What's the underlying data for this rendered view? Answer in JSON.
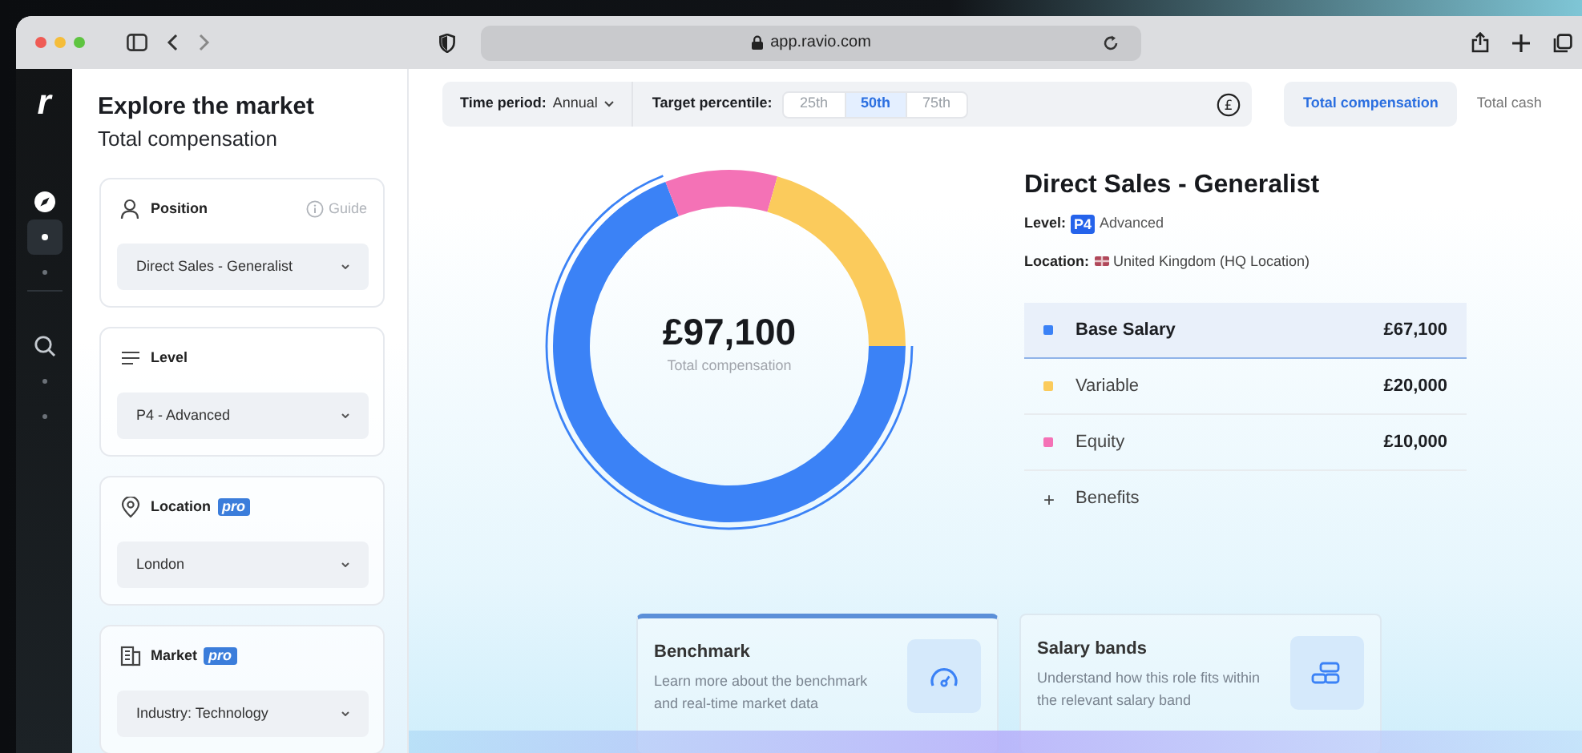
{
  "browser": {
    "url": "app.ravio.com"
  },
  "sidebar": {
    "logo": "r",
    "items": [
      {
        "kind": "compass",
        "selected": false
      },
      {
        "kind": "dot",
        "selected": true
      },
      {
        "kind": "dot",
        "selected": false
      },
      {
        "kind": "search",
        "selected": false
      },
      {
        "kind": "dot",
        "selected": false
      },
      {
        "kind": "dot",
        "selected": false
      }
    ]
  },
  "header": {
    "title": "Explore the market",
    "subtitle": "Total compensation"
  },
  "filters": [
    {
      "kind": "person",
      "label": "Position",
      "guide": "Guide",
      "value": "Direct Sales - Generalist"
    },
    {
      "kind": "lines",
      "label": "Level",
      "value": "P4 - Advanced"
    },
    {
      "kind": "pin",
      "label": "Location",
      "badge": "pro",
      "value": "London"
    },
    {
      "kind": "building",
      "label": "Market",
      "badge": "pro",
      "value": "Industry: Technology"
    }
  ],
  "toolbar": {
    "currency_icon": "£",
    "time_label": "Time period:",
    "time_value": "Annual",
    "percentile_label": "Target percentile:",
    "percentiles": [
      {
        "label": "25th",
        "selected": false
      },
      {
        "label": "50th",
        "selected": true
      },
      {
        "label": "75th",
        "selected": false
      }
    ]
  },
  "view_tabs": [
    {
      "label": "Total compensation",
      "selected": true
    },
    {
      "label": "Total cash",
      "selected": false
    }
  ],
  "chart": {
    "total": "£97,100",
    "total_label": "Total compensation",
    "chart_data": {
      "type": "donut",
      "values": [
        69.1,
        10.3,
        20.6
      ]
    }
  },
  "role": {
    "title": "Direct Sales - Generalist",
    "level_label": "Level:",
    "level_badge": "P4",
    "level_name": "Advanced",
    "location_label": "Location:",
    "location": "United Kingdom (HQ Location)"
  },
  "components": [
    {
      "name": "Base Salary",
      "amount": "£67,100",
      "color": "#3b82f6",
      "selected": true
    },
    {
      "name": "Variable",
      "amount": "£20,000",
      "color": "#fbcb5c",
      "selected": false
    },
    {
      "name": "Equity",
      "amount": "£10,000",
      "color": "#f472b6",
      "selected": false
    }
  ],
  "benefits": {
    "icon": "+",
    "label": "Benefits"
  },
  "cards": [
    {
      "kind": "gauge",
      "title": "Benchmark",
      "description": "Learn more about the benchmark and real-time market data",
      "selected": true
    },
    {
      "kind": "bands",
      "title": "Salary bands",
      "description": "Understand how this role fits within the relevant salary band",
      "selected": false
    }
  ]
}
